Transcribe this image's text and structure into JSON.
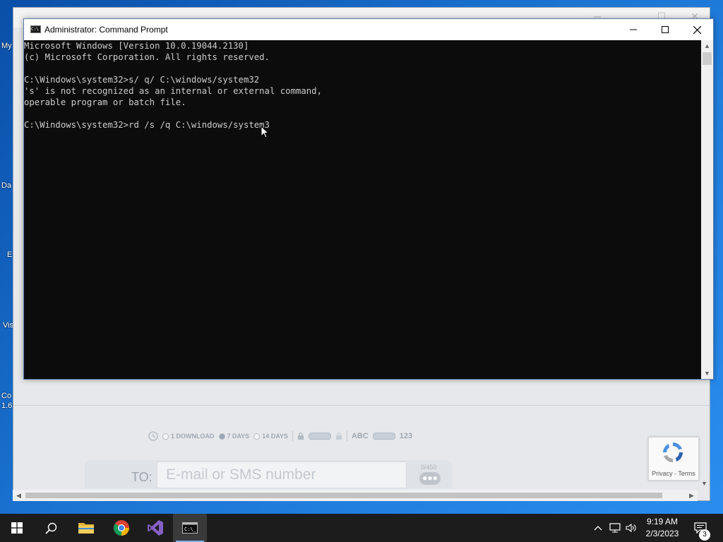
{
  "desktop": {
    "icon_labels": [
      "My",
      "Da",
      "E",
      "Vis",
      "Co",
      "1.6"
    ]
  },
  "browser": {
    "options": {
      "download_label": "1 DOWNLOAD",
      "seven_days_label": "7 DAYS",
      "fourteen_days_label": "14 DAYS",
      "abc_label": "ABC",
      "numeric_label": "123"
    },
    "to_label": "TO:",
    "email_placeholder": "E-mail or SMS number",
    "char_counter": "0/450",
    "recaptcha_terms": "Privacy - Terms"
  },
  "cmd": {
    "title": "Administrator: Command Prompt",
    "lines": [
      "Microsoft Windows [Version 10.0.19044.2130]",
      "(c) Microsoft Corporation. All rights reserved.",
      "",
      "C:\\Windows\\system32>s/ q/ C:\\windows/system32",
      "'s' is not recognized as an internal or external command,",
      "operable program or batch file.",
      "",
      "C:\\Windows\\system32>rd /s /q C:\\windows/system3"
    ]
  },
  "taskbar": {
    "apps": [
      "start",
      "search",
      "file-explorer",
      "chrome",
      "visual-studio",
      "command-prompt"
    ],
    "time": "9:19 AM",
    "date": "2/3/2023",
    "notification_count": "3"
  }
}
